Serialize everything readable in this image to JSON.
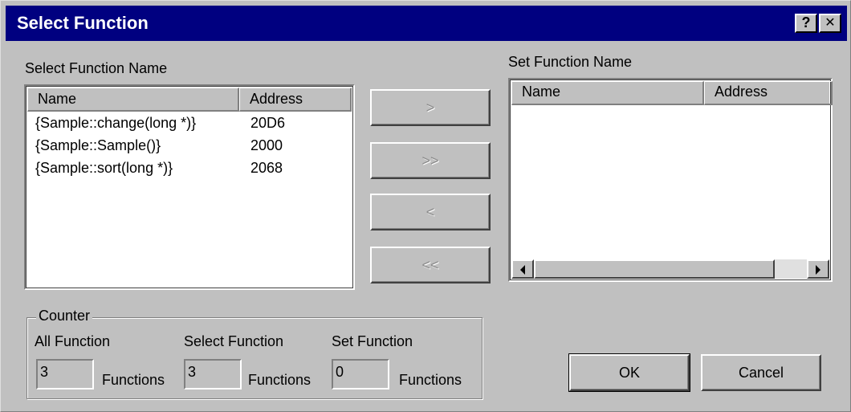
{
  "window": {
    "title": "Select Function",
    "help_glyph": "?",
    "close_glyph": "✕"
  },
  "left": {
    "label": "Select Function Name",
    "columns": [
      "Name",
      "Address"
    ],
    "rows": [
      {
        "name": "{Sample::change(long *)}",
        "address": "20D6"
      },
      {
        "name": "{Sample::Sample()}",
        "address": "2000"
      },
      {
        "name": "{Sample::sort(long *)}",
        "address": "2068"
      }
    ]
  },
  "right": {
    "label": "Set Function Name",
    "columns": [
      "Name",
      "Address"
    ],
    "rows": []
  },
  "move_buttons": {
    "add_one": ">",
    "add_all": ">>",
    "remove_one": "<",
    "remove_all": "<<"
  },
  "counter": {
    "title": "Counter",
    "all_label": "All Function",
    "select_label": "Select Function",
    "set_label": "Set Function",
    "all_value": "3",
    "select_value": "3",
    "set_value": "0",
    "unit": "Functions"
  },
  "actions": {
    "ok": "OK",
    "cancel": "Cancel"
  }
}
